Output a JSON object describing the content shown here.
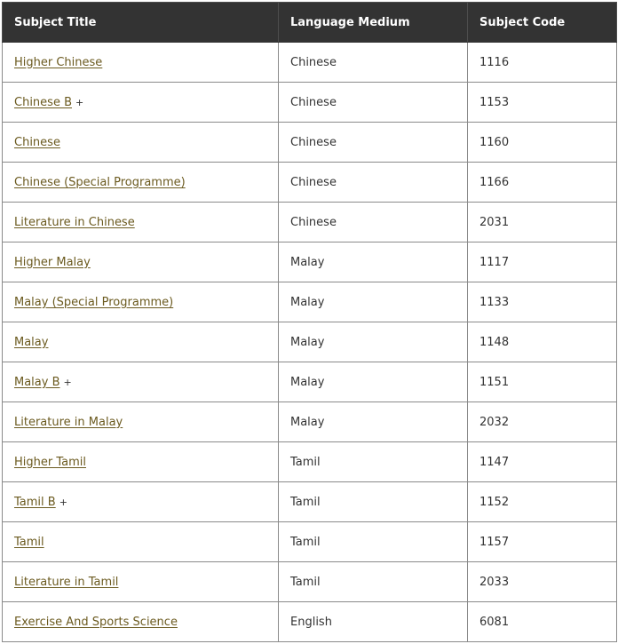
{
  "table": {
    "headers": [
      "Subject Title",
      "Language Medium",
      "Subject Code"
    ],
    "rows": [
      {
        "title": "Higher Chinese",
        "suffix": "",
        "medium": "Chinese",
        "code": "1116"
      },
      {
        "title": "Chinese B",
        "suffix": "+",
        "medium": "Chinese",
        "code": "1153"
      },
      {
        "title": "Chinese",
        "suffix": "",
        "medium": "Chinese",
        "code": "1160"
      },
      {
        "title": "Chinese (Special Programme)",
        "suffix": "",
        "medium": "Chinese",
        "code": "1166"
      },
      {
        "title": "Literature in Chinese",
        "suffix": "",
        "medium": "Chinese",
        "code": "2031"
      },
      {
        "title": "Higher Malay",
        "suffix": "",
        "medium": "Malay",
        "code": "1117"
      },
      {
        "title": "Malay (Special Programme)",
        "suffix": "",
        "medium": "Malay",
        "code": "1133"
      },
      {
        "title": "Malay",
        "suffix": "",
        "medium": "Malay",
        "code": "1148"
      },
      {
        "title": "Malay B",
        "suffix": "+",
        "medium": "Malay",
        "code": "1151"
      },
      {
        "title": "Literature in Malay",
        "suffix": "",
        "medium": "Malay",
        "code": "2032"
      },
      {
        "title": "Higher Tamil",
        "suffix": "",
        "medium": "Tamil",
        "code": "1147"
      },
      {
        "title": "Tamil B",
        "suffix": "+",
        "medium": "Tamil",
        "code": "1152"
      },
      {
        "title": "Tamil",
        "suffix": "",
        "medium": "Tamil",
        "code": "1157"
      },
      {
        "title": "Literature in Tamil",
        "suffix": "",
        "medium": "Tamil",
        "code": "2033"
      },
      {
        "title": "Exercise And Sports Science",
        "suffix": "",
        "medium": "English",
        "code": "6081"
      }
    ]
  },
  "colors": {
    "header_bg": "#333333",
    "link": "#6b5a1f",
    "border": "#8a8a8a"
  }
}
